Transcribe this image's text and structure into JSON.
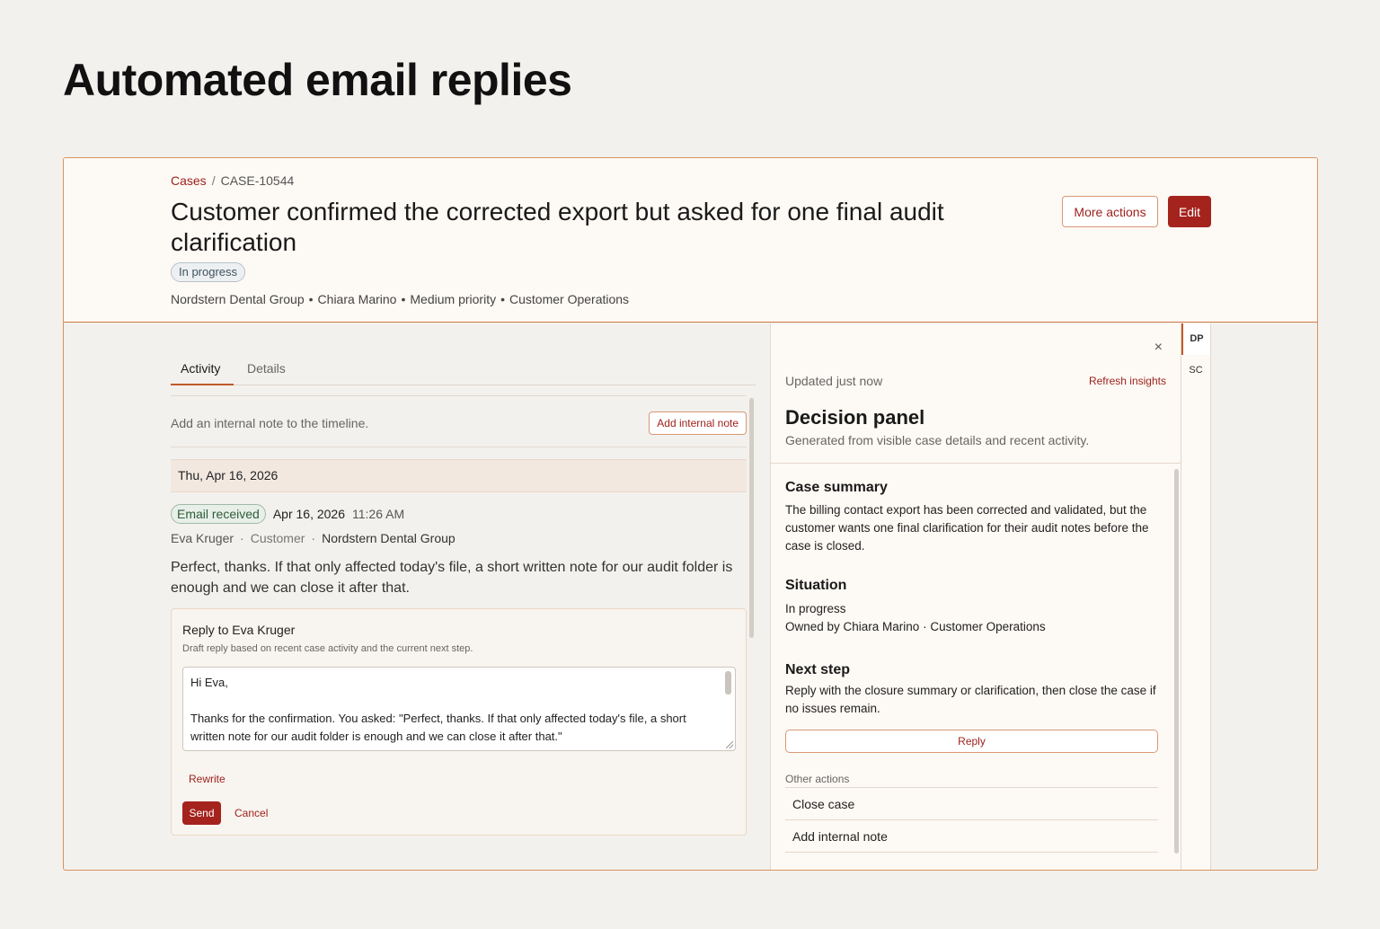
{
  "page": {
    "title": "Automated email replies"
  },
  "header": {
    "breadcrumb": {
      "link": "Cases",
      "separator": "/",
      "current": "CASE-10544"
    },
    "case_title": "Customer confirmed the corrected export but asked for one final audit clarification",
    "status": "In progress",
    "meta": [
      "Nordstern Dental Group",
      "Chiara Marino",
      "Medium priority",
      "Customer Operations"
    ],
    "meta_separator": "•",
    "more_actions_label": "More actions",
    "edit_label": "Edit"
  },
  "activity": {
    "tabs": [
      {
        "label": "Activity",
        "active": true
      },
      {
        "label": "Details",
        "active": false
      }
    ],
    "note_hint": "Add an internal note to the timeline.",
    "add_note_label": "Add internal note",
    "date_header": "Thu, Apr 16, 2026",
    "event": {
      "badge": "Email received",
      "date": "Apr 16, 2026",
      "time": "11:26 AM",
      "sender_name": "Eva Kruger",
      "sender_role": "Customer",
      "sender_org": "Nordstern Dental Group",
      "sender_separator": "·",
      "body": "Perfect, thanks. If that only affected today's file, a short written note for our audit folder is enough and we can close it after that."
    },
    "reply": {
      "title": "Reply to Eva Kruger",
      "subtitle": "Draft reply based on recent case activity and the current next step.",
      "greeting": "Hi Eva,",
      "draft": "Thanks for the confirmation. You asked: \"Perfect, thanks. If that only affected today's file, a short written note for our audit folder is enough and we can close it after that.\"",
      "rewrite_label": "Rewrite",
      "send_label": "Send",
      "cancel_label": "Cancel"
    }
  },
  "panel": {
    "close_icon": "×",
    "updated": "Updated just now",
    "refresh_label": "Refresh insights",
    "title": "Decision panel",
    "subtitle": "Generated from visible case details and recent activity.",
    "summary": {
      "title": "Case summary",
      "text": "The billing contact export has been corrected and validated, but the customer wants one final clarification for their audit notes before the case is closed."
    },
    "situation": {
      "title": "Situation",
      "status": "In progress",
      "owner": "Owned by Chiara Marino · Customer Operations"
    },
    "next_step": {
      "title": "Next step",
      "text": "Reply with the closure summary or clarification, then close the case if no issues remain.",
      "reply_label": "Reply"
    },
    "other_actions": {
      "label": "Other actions",
      "items": [
        "Close case",
        "Add internal note"
      ]
    }
  },
  "rail": {
    "tabs": [
      {
        "label": "DP",
        "active": true
      },
      {
        "label": "SC",
        "active": false
      }
    ]
  },
  "colors": {
    "accent": "#a5231d",
    "accent_border": "#cf7a45",
    "background": "#f3f1ed",
    "surface": "#fdf9f4"
  }
}
